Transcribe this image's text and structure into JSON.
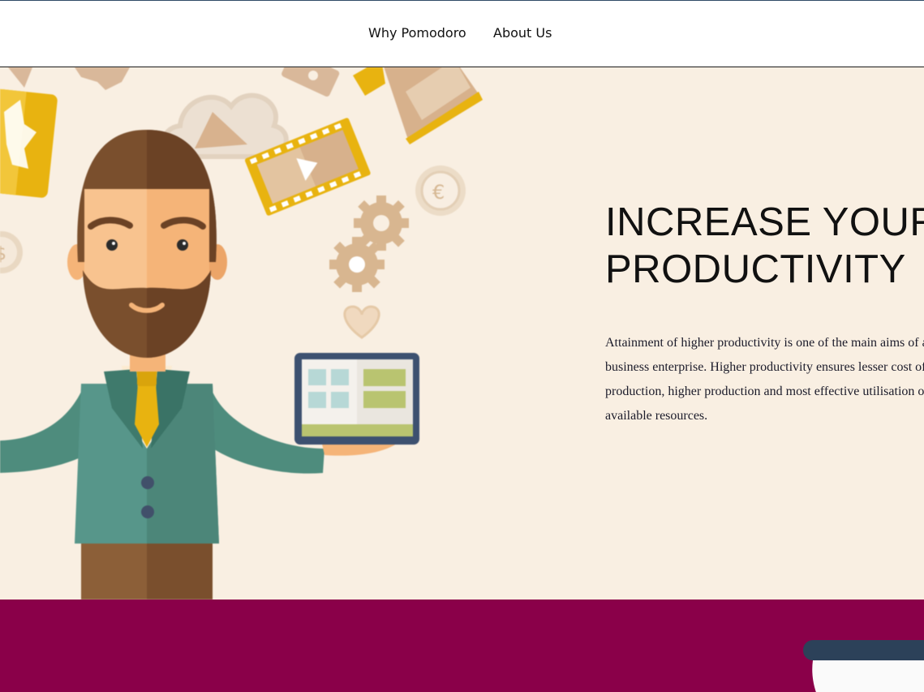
{
  "nav": {
    "items": [
      {
        "label": "Why Pomodoro"
      },
      {
        "label": "About Us"
      }
    ]
  },
  "hero": {
    "title_lines": [
      "INCREASE YOUR",
      "PRODUCTIVITY"
    ],
    "body_lines": [
      "Attainment of higher productivity is one of the main aims of a",
      "business enterprise. Higher productivity ensures lesser cost of",
      "production, higher production and most effective utilisation of",
      "available resources."
    ],
    "background_color": "#f9efe2",
    "illustration_icons": [
      "businessman-icon",
      "tablet-icon",
      "cloud-icon",
      "film-strip-icon",
      "megaphone-icon",
      "euro-coin-icon",
      "gear-icon",
      "heart-icon",
      "map-icon",
      "dollar-coin-icon"
    ]
  },
  "band": {
    "background_color": "#8a0049",
    "icons": [
      "coffee-cup-icon"
    ]
  },
  "colors": {
    "nav_border": "#2e4a66",
    "text_dark": "#111111"
  }
}
